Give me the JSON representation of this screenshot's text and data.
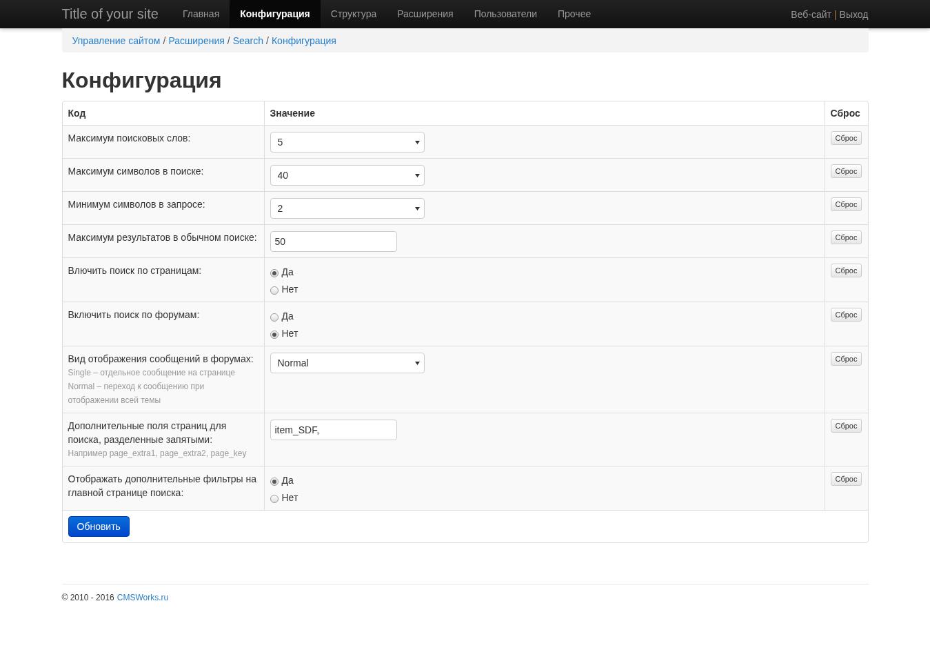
{
  "navbar": {
    "brand": "Title of your site",
    "items": [
      {
        "label": "Главная",
        "selected": false
      },
      {
        "label": "Конфигурация",
        "selected": true
      },
      {
        "label": "Структура",
        "selected": false
      },
      {
        "label": "Расширения",
        "selected": false
      },
      {
        "label": "Пользователи",
        "selected": false
      },
      {
        "label": "Прочее",
        "selected": false
      }
    ],
    "right": {
      "website": "Веб-сайт",
      "separator": "|",
      "logout": "Выход"
    }
  },
  "breadcrumb": {
    "items": [
      "Управление сайтом",
      "Расширения",
      "Search",
      "Конфигурация"
    ],
    "separator": "/"
  },
  "page_title": "Конфигурация",
  "table": {
    "columns": [
      "Код",
      "Значение",
      "Сброс"
    ],
    "rows": [
      {
        "label": "Максимум поисковых слов:",
        "kind": "select",
        "value": "5",
        "reset": "Сброс"
      },
      {
        "label": "Максимум символов в поиске:",
        "kind": "select",
        "value": "40",
        "reset": "Сброс"
      },
      {
        "label": "Минимум символов в запросе:",
        "kind": "select",
        "value": "2",
        "reset": "Сброс"
      },
      {
        "label": "Максимум результатов в обычном поиске:",
        "kind": "text",
        "value": "50",
        "reset": "Сброс"
      },
      {
        "label": "Влючить поиск по страницам:",
        "kind": "radio",
        "options": [
          {
            "label": "Да",
            "selected": true
          },
          {
            "label": "Нет",
            "selected": false
          }
        ],
        "reset": "Сброс"
      },
      {
        "label": "Включить поиск по форумам:",
        "kind": "radio",
        "options": [
          {
            "label": "Да",
            "selected": false
          },
          {
            "label": "Нет",
            "selected": true
          }
        ],
        "reset": "Сброс"
      },
      {
        "label": "Вид отображения сообщений в форумах:",
        "hint": [
          "Single – отдельное сообщение на странице",
          "Normal – переход к сообщению при",
          "отображении всей темы"
        ],
        "kind": "select",
        "value": "Normal",
        "reset": "Сброс"
      },
      {
        "label": "Дополнительные поля страниц для поиска, разделенные запятыми:",
        "hint": [
          "Например page_extra1, page_extra2, page_key"
        ],
        "kind": "text",
        "value": "item_SDF,",
        "reset": "Сброс"
      },
      {
        "label": "Отображать дополнительные фильтры на главной странице поиска:",
        "kind": "radio",
        "options": [
          {
            "label": "Да",
            "selected": true
          },
          {
            "label": "Нет",
            "selected": false
          }
        ],
        "reset": "Сброс"
      }
    ],
    "submit": "Обновить"
  },
  "footer": {
    "copyright": "© 2010 - 2016",
    "link": "CMSWorks.ru"
  }
}
